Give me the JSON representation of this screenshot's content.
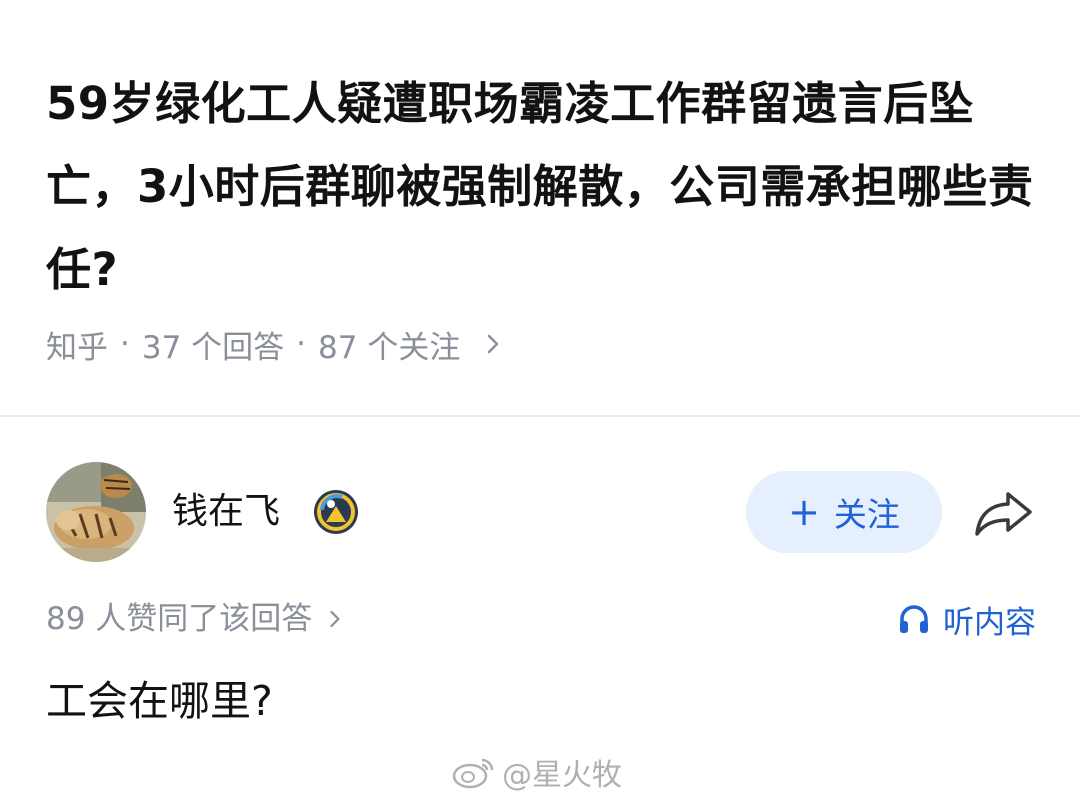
{
  "question": {
    "title": "59岁绿化工人疑遭职场霸凌工作群留遗言后坠亡，3小时后群聊被强制解散，公司需承担哪些责任?",
    "source": "知乎",
    "answers": "37 个回答",
    "followers": "87 个关注",
    "separator": "·"
  },
  "author": {
    "name": "钱在飞",
    "avatar_icon": "tiger-avatar",
    "badge_icon": "verified-badge-icon"
  },
  "actions": {
    "follow_plus": "+",
    "follow_label": "关注",
    "share_icon": "share-arrow-icon"
  },
  "answer": {
    "upvotes": "89 人赞同了该回答",
    "listen_label": "听内容",
    "listen_icon": "headphones-icon",
    "body": "工会在哪里?"
  },
  "watermark": {
    "text": "@星火牧",
    "icon": "weibo-icon"
  },
  "colors": {
    "accent": "#1f62d6",
    "follow_bg": "#e5effd",
    "meta_gray": "#8a8f99",
    "text": "#121212",
    "divider": "#ebebeb"
  }
}
